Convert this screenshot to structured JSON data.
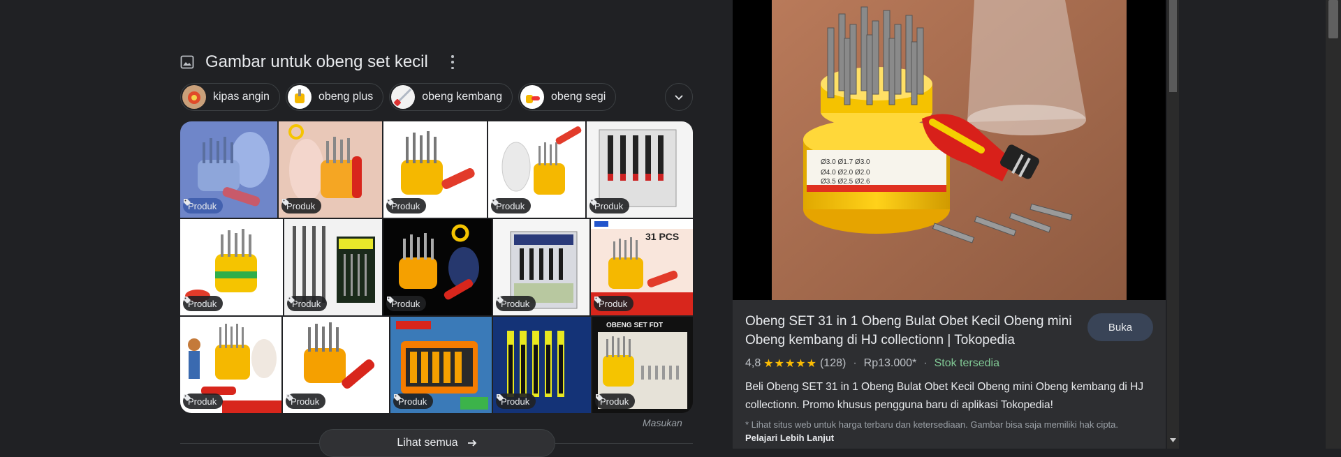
{
  "section": {
    "title": "Gambar untuk obeng set kecil",
    "icon": "image-icon"
  },
  "chips": [
    {
      "label": "kipas angin"
    },
    {
      "label": "obeng plus"
    },
    {
      "label": "obeng kembang"
    },
    {
      "label": "obeng segi"
    }
  ],
  "grid": {
    "badge_label": "Produk"
  },
  "feedback_label": "Masukan",
  "see_all_label": "Lihat semua",
  "preview": {
    "title": "Obeng SET 31 in 1 Obeng Bulat Obet Kecil Obeng mini Obeng kembang di HJ collectionn | Tokopedia",
    "open_label": "Buka",
    "rating": "4,8",
    "stars": "★★★★★",
    "review_count": "(128)",
    "price": "Rp13.000*",
    "stock": "Stok tersedia",
    "description": "Beli Obeng SET 31 in 1 Obeng Bulat Obet Kecil Obeng mini Obeng kembang di HJ collectionn. Promo khusus pengguna baru di aplikasi Tokopedia!",
    "disclaimer": "* Lihat situs web untuk harga terbaru dan ketersediaan. Gambar bisa saja memiliki hak cipta.",
    "learn_more": "Pelajari Lebih Lanjut"
  },
  "colors": {
    "background": "#202124",
    "panel": "#2d2e31",
    "accent_button": "#394457",
    "stars": "#fbbc04",
    "stock": "#81c995"
  }
}
